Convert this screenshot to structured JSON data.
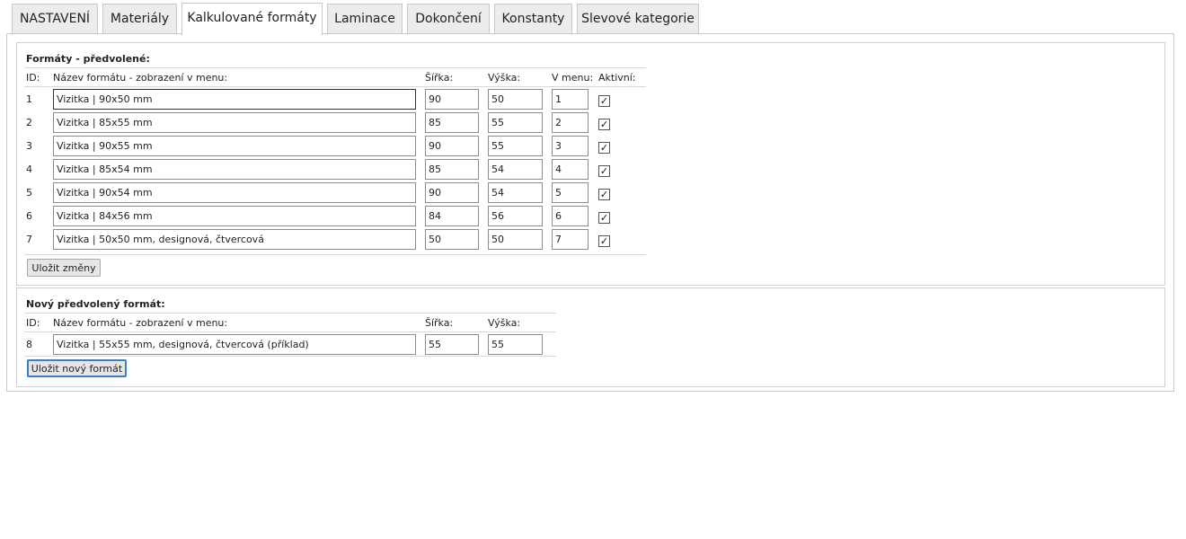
{
  "tabs": [
    {
      "label": "NASTAVENÍ"
    },
    {
      "label": "Materiály"
    },
    {
      "label": "Kalkulované formáty",
      "active": true
    },
    {
      "label": "Laminace"
    },
    {
      "label": "Dokončení"
    },
    {
      "label": "Konstanty"
    },
    {
      "label": "Slevové kategorie"
    }
  ],
  "preset": {
    "heading": "Formáty - předvolené:",
    "columns": {
      "id": "ID:",
      "name": "Název formátu - zobrazení v menu:",
      "width": "Šířka:",
      "height": "Výška:",
      "order": "V menu:",
      "active": "Aktivní:"
    },
    "rows": [
      {
        "id": "1",
        "name": "Vizitka | 90x50 mm",
        "width": "90",
        "height": "50",
        "order": "1",
        "active": true
      },
      {
        "id": "2",
        "name": "Vizitka | 85x55 mm",
        "width": "85",
        "height": "55",
        "order": "2",
        "active": true
      },
      {
        "id": "3",
        "name": "Vizitka | 90x55 mm",
        "width": "90",
        "height": "55",
        "order": "3",
        "active": true
      },
      {
        "id": "4",
        "name": "Vizitka | 85x54 mm",
        "width": "85",
        "height": "54",
        "order": "4",
        "active": true
      },
      {
        "id": "5",
        "name": "Vizitka | 90x54 mm",
        "width": "90",
        "height": "54",
        "order": "5",
        "active": true
      },
      {
        "id": "6",
        "name": "Vizitka | 84x56 mm",
        "width": "84",
        "height": "56",
        "order": "6",
        "active": true
      },
      {
        "id": "7",
        "name": "Vizitka | 50x50 mm, designová, čtvercová",
        "width": "50",
        "height": "50",
        "order": "7",
        "active": true
      }
    ],
    "save_label": "Uložit změny"
  },
  "new_format": {
    "heading": "Nový předvolený formát:",
    "columns": {
      "id": "ID:",
      "name": "Název formátu - zobrazení v menu:",
      "width": "Šířka:",
      "height": "Výška:"
    },
    "row": {
      "id": "8",
      "name": "Vizitka | 55x55 mm, designová, čtvercová (příklad)",
      "width": "55",
      "height": "55"
    },
    "save_label": "Uložit nový formát"
  },
  "checkmark_glyph": "✓"
}
